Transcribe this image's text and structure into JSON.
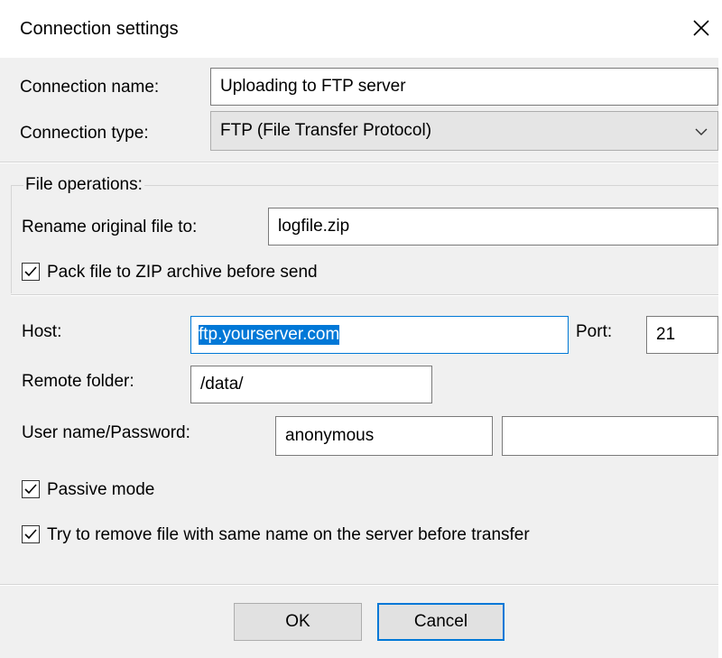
{
  "dialog": {
    "title": "Connection settings",
    "close_icon": "close-icon"
  },
  "connection": {
    "name_label": "Connection name:",
    "name_value": "Uploading to FTP server",
    "type_label": "Connection type:",
    "type_value": "FTP (File Transfer Protocol)"
  },
  "file_operations": {
    "group_label": "File operations:",
    "rename_label": "Rename original file to:",
    "rename_value": "logfile.zip",
    "pack_zip_label": "Pack file to ZIP archive before send",
    "pack_zip_checked": true
  },
  "server": {
    "host_label": "Host:",
    "host_value": "ftp.yourserver.com",
    "port_label": "Port:",
    "port_value": "21",
    "remote_folder_label": "Remote folder:",
    "remote_folder_value": "/data/",
    "credentials_label": "User name/Password:",
    "username_value": "anonymous",
    "password_value": "",
    "passive_mode_label": "Passive mode",
    "passive_mode_checked": true,
    "remove_existing_label": "Try to remove file with same name on the server before transfer",
    "remove_existing_checked": true
  },
  "buttons": {
    "ok_label": "OK",
    "cancel_label": "Cancel"
  },
  "colors": {
    "accent": "#0078d7",
    "background": "#f0f0f0"
  }
}
